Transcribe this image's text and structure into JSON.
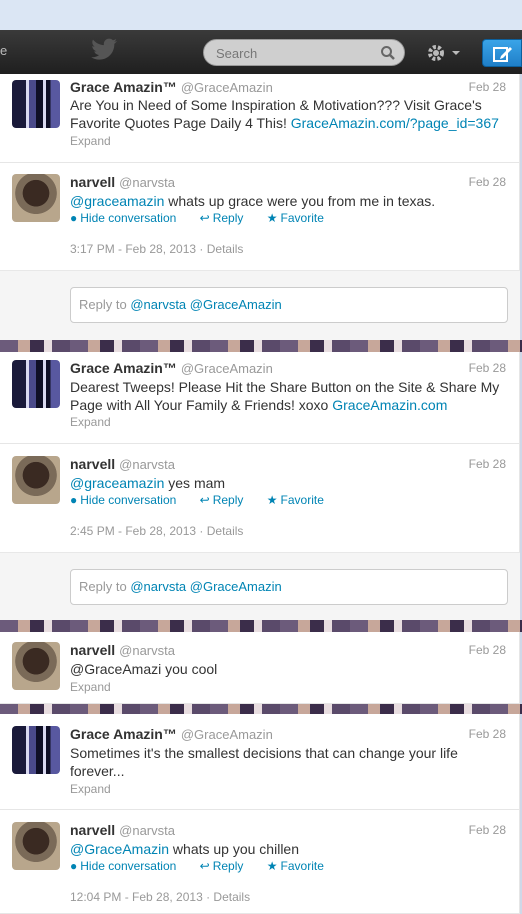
{
  "nav": {
    "left_fragment": "e",
    "search_placeholder": "Search"
  },
  "tweets": [
    {
      "name": "Grace Amazin™",
      "handle": "@GraceAmazin",
      "date": "Feb 28",
      "text": "Are You in Need of Some Inspiration & Motivation??? Visit Grace's Favorite Quotes Page Daily 4 This!",
      "link": "GraceAmazin.com/?page_id=367",
      "expand": "Expand"
    },
    {
      "name": "narvell",
      "handle": "@narvsta",
      "date": "Feb 28",
      "mention": "@graceamazin",
      "text": "whats up grace were you from me in texas.",
      "actions": {
        "hide": "Hide conversation",
        "reply": "Reply",
        "favorite": "Favorite"
      },
      "meta": "3:17 PM - Feb 28, 2013 · Details",
      "reply_box": {
        "prefix": "Reply to",
        "handles": "@narvsta @GraceAmazin"
      }
    },
    {
      "name": "Grace Amazin™",
      "handle": "@GraceAmazin",
      "date": "Feb 28",
      "text": "Dearest Tweeps! Please Hit the Share Button on the Site & Share My Page with All Your Family & Friends! xoxo",
      "link": "GraceAmazin.com",
      "expand": "Expand"
    },
    {
      "name": "narvell",
      "handle": "@narvsta",
      "date": "Feb 28",
      "mention": "@graceamazin",
      "text": "yes mam",
      "actions": {
        "hide": "Hide conversation",
        "reply": "Reply",
        "favorite": "Favorite"
      },
      "meta": "2:45 PM - Feb 28, 2013 · Details",
      "reply_box": {
        "prefix": "Reply to",
        "handles": "@narvsta @GraceAmazin"
      }
    },
    {
      "name": "narvell",
      "handle": "@narvsta",
      "date": "Feb 28",
      "text": "@GraceAmazi you cool",
      "expand": "Expand"
    },
    {
      "name": "Grace Amazin™",
      "handle": "@GraceAmazin",
      "date": "Feb 28",
      "text": "Sometimes it's the smallest decisions that can change your life forever...",
      "expand": "Expand"
    },
    {
      "name": "narvell",
      "handle": "@narvsta",
      "date": "Feb 28",
      "mention": "@GraceAmazin",
      "text": "whats up you chillen",
      "actions": {
        "hide": "Hide conversation",
        "reply": "Reply",
        "favorite": "Favorite"
      },
      "meta": "12:04 PM - Feb 28, 2013 · Details"
    }
  ],
  "colors": {
    "link": "#0084b4",
    "navbar": "#2a2a2a",
    "compose": "#2b8fd6"
  }
}
